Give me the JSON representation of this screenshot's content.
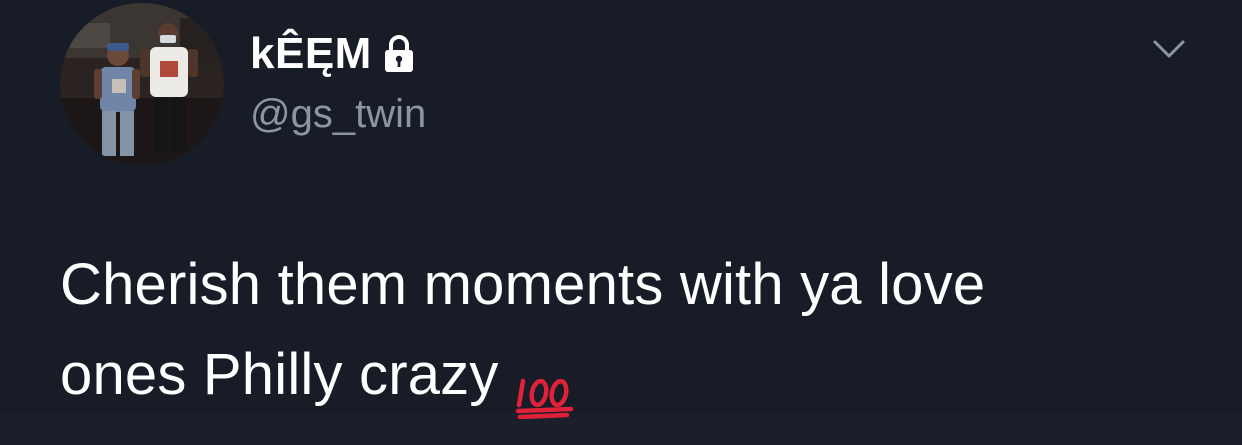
{
  "user": {
    "display_name": "kÊĘM",
    "handle": "@gs_twin",
    "protected_icon": "lock-icon",
    "avatar": "profile-photo"
  },
  "menu": {
    "icon": "chevron-down-icon"
  },
  "tweet": {
    "line1": "Cherish them moments with ya love",
    "line2": "ones Philly crazy",
    "emoji": "hundred-points-emoji"
  },
  "colors": {
    "background": "#181c27",
    "text": "#ffffff",
    "secondary": "#8b96a3",
    "emoji_red": "#e0213a"
  }
}
